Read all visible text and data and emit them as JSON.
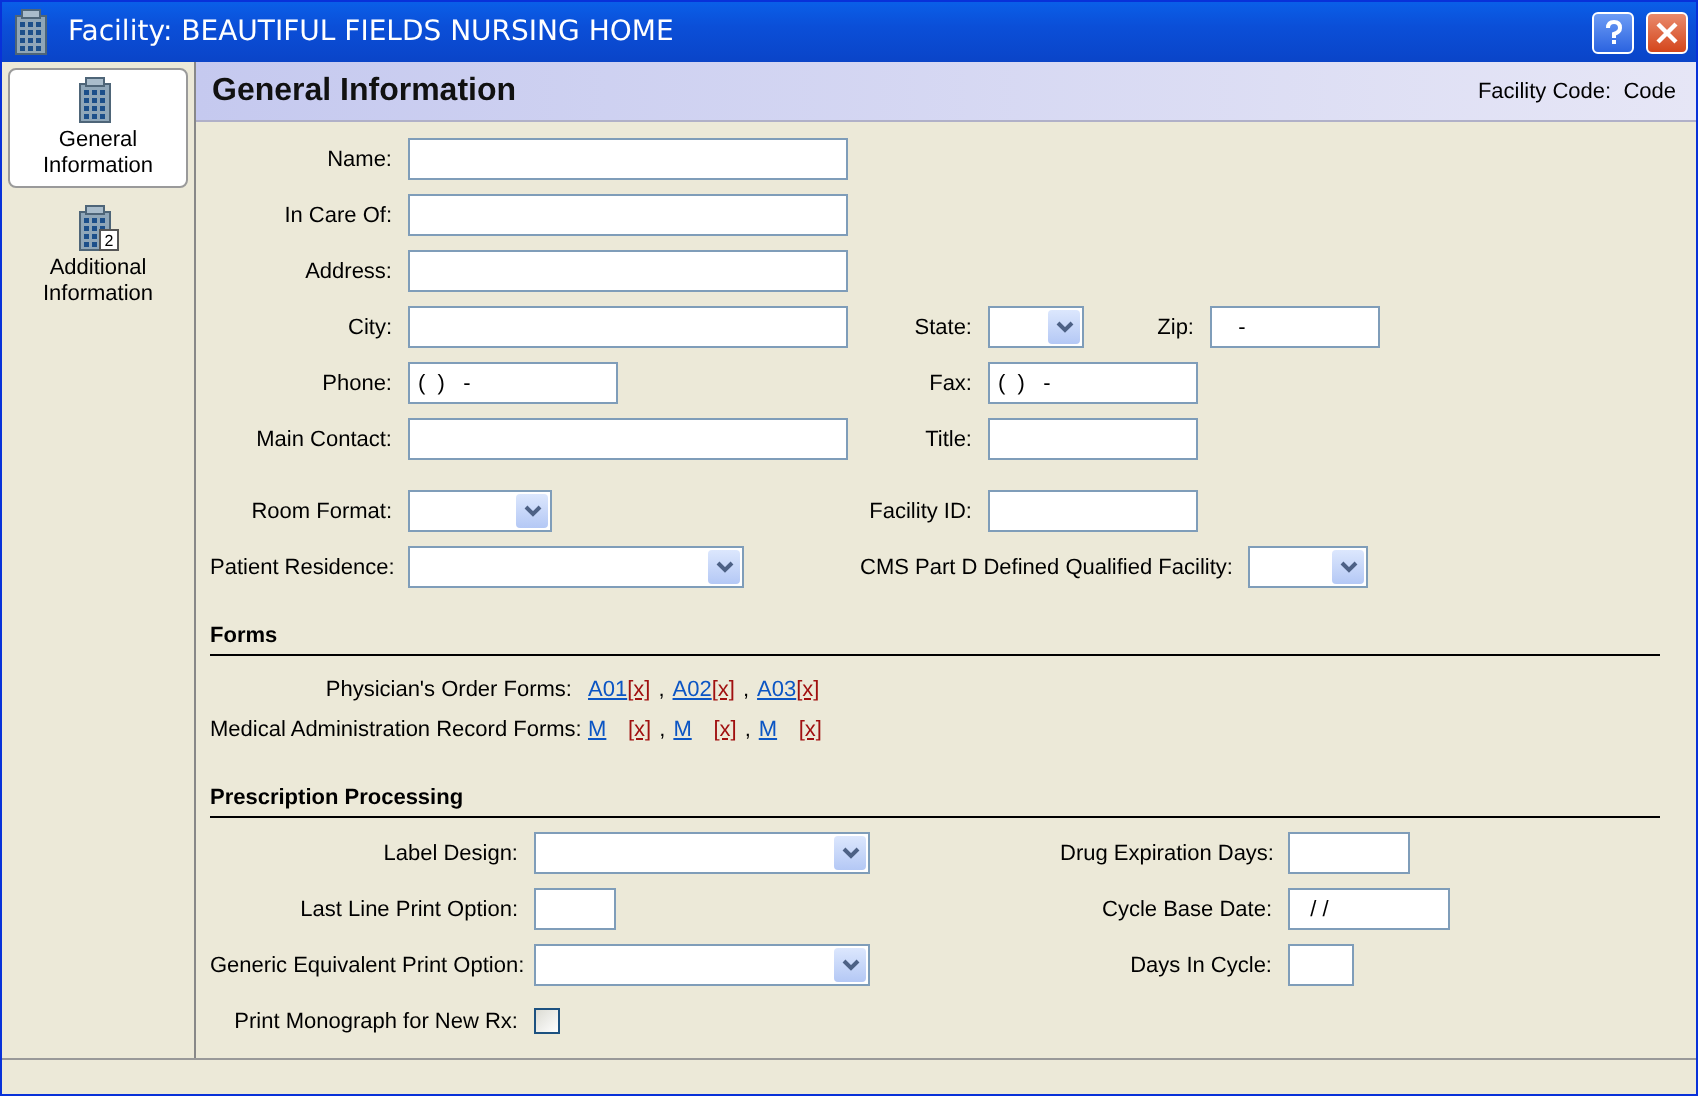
{
  "window": {
    "title": "Facility: BEAUTIFUL FIELDS NURSING HOME"
  },
  "sidebar": {
    "items": [
      {
        "label": "General Information",
        "selected": true
      },
      {
        "label": "Additional Information",
        "selected": false,
        "badge": "2"
      }
    ]
  },
  "header": {
    "title": "General Information",
    "code_label": "Facility Code:",
    "code_value": "Code"
  },
  "general": {
    "rows": [
      {
        "left": {
          "label": "Name:",
          "kind": "text"
        },
        "right": []
      },
      {
        "left": {
          "label": "In Care Of:",
          "kind": "text"
        },
        "right": []
      },
      {
        "left": {
          "label": "Address:",
          "kind": "text"
        },
        "right": []
      },
      {
        "left": {
          "label": "City:",
          "kind": "text"
        },
        "right": [
          {
            "label": "State:",
            "kind": "dropdown"
          },
          {
            "label": "Zip:",
            "kind": "text",
            "value": "   -"
          }
        ]
      },
      {
        "left": {
          "label": "Phone:",
          "kind": "text",
          "value": "(  )   -"
        },
        "right": [
          {
            "label": "Fax:",
            "kind": "text",
            "value": "(  )   -"
          }
        ]
      },
      {
        "left": {
          "label": "Main Contact:",
          "kind": "text"
        },
        "right": [
          {
            "label": "Title:",
            "kind": "text"
          }
        ]
      },
      {
        "left": {
          "label": "Room Format:",
          "kind": "dropdown"
        },
        "right": [
          {
            "label": "Facility ID:",
            "kind": "text"
          }
        ]
      },
      {
        "left": {
          "label": "Patient Residence:",
          "kind": "dropdown"
        },
        "right": [
          {
            "label": "CMS Part D Defined Qualified Facility:",
            "kind": "dropdown"
          }
        ]
      }
    ]
  },
  "forms": {
    "title": "Forms",
    "separator": ",",
    "rows": [
      {
        "label": "Physician's Order Forms:",
        "items": [
          {
            "code": "A01",
            "remove": "[x]"
          },
          {
            "code": "A02",
            "remove": "[x]"
          },
          {
            "code": "A03",
            "remove": "[x]"
          }
        ]
      },
      {
        "label": "Medical Administration Record Forms:",
        "items": [
          {
            "code": "M",
            "remove": "[x]"
          },
          {
            "code": "M",
            "remove": "[x]"
          },
          {
            "code": "M",
            "remove": "[x]"
          }
        ]
      }
    ]
  },
  "prescription": {
    "title": "Prescription Processing",
    "rows": [
      {
        "left": {
          "label": "Label Design:",
          "kind": "dropdown"
        },
        "right": {
          "label": "Drug Expiration Days:",
          "kind": "text"
        }
      },
      {
        "left": {
          "label": "Last Line Print Option:",
          "kind": "text"
        },
        "right": {
          "label": "Cycle Base Date:",
          "kind": "text",
          "value": "  / /"
        }
      },
      {
        "left": {
          "label": "Generic Equivalent Print Option:",
          "kind": "dropdown"
        },
        "right": {
          "label": "Days In Cycle:",
          "kind": "text"
        }
      },
      {
        "left": {
          "label": "Print Monograph for New Rx:",
          "kind": "checkbox",
          "checked": false
        }
      }
    ]
  }
}
